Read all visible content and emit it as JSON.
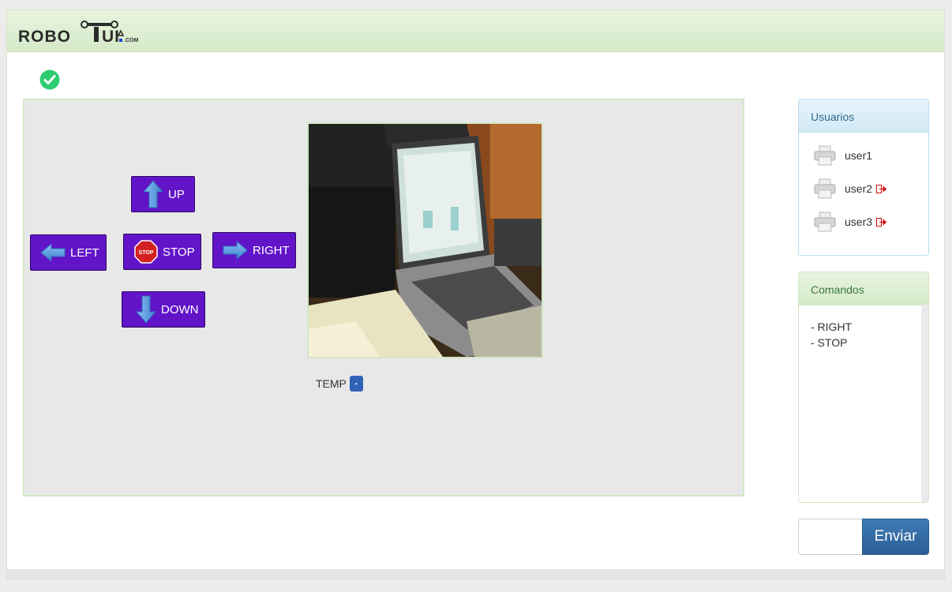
{
  "header": {
    "logo_text": "ROBOTUI",
    "logo_suffix": ".COM"
  },
  "status": {
    "icon": "check-circle-icon",
    "color": "#2ecc71"
  },
  "controls": {
    "up_label": "UP",
    "left_label": "LEFT",
    "stop_label": "STOP",
    "right_label": "RIGHT",
    "down_label": "DOWN",
    "stop_sign_text": "STOP"
  },
  "sensor": {
    "temp_label": "TEMP",
    "temp_value": "-"
  },
  "users_panel": {
    "title": "Usuarios",
    "users": [
      {
        "name": "user1",
        "logged_out": false
      },
      {
        "name": "user2",
        "logged_out": true
      },
      {
        "name": "user3",
        "logged_out": true
      }
    ]
  },
  "commands_panel": {
    "title": "Comandos",
    "commands": [
      "- RIGHT",
      "- STOP"
    ]
  },
  "send": {
    "input_value": "",
    "button_label": "Enviar"
  },
  "colors": {
    "control_button": "#6214c8",
    "header_green": "#d5eac8",
    "send_button": "#2a5f95",
    "arrow_blue": "#4a8fd6"
  }
}
